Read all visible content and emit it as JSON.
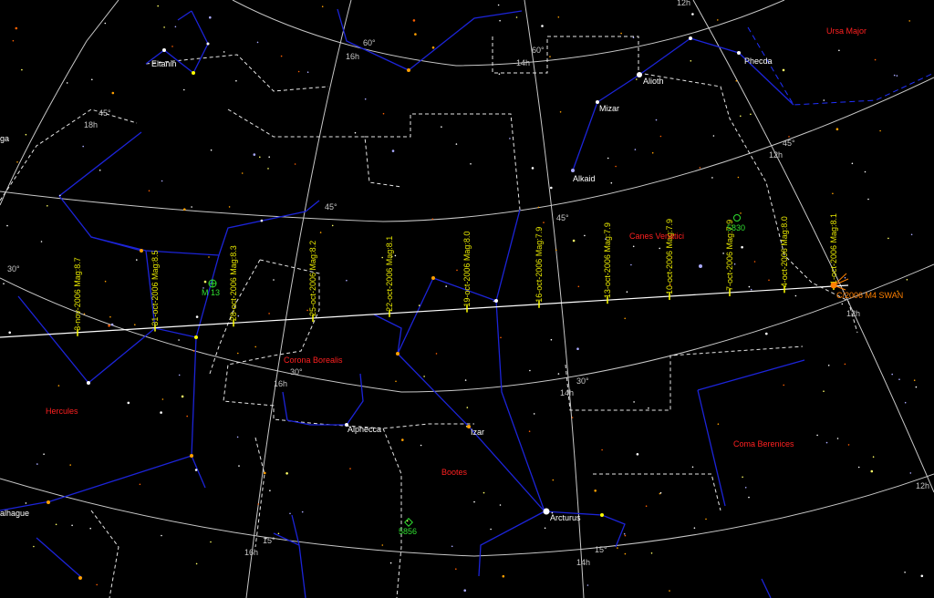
{
  "colors": {
    "background": "#000000",
    "grid": "#c8c8c8",
    "boundary": "#e6e6e6",
    "constellation_line": "#1c24d8",
    "ecliptic_dash": "#2030ff",
    "comet_path": "#ffffff",
    "comet_tick": "#ffff00",
    "date_label": "#e8e800",
    "const_name": "#ff2020",
    "star_label": "#ffffff",
    "dso": "#30e030",
    "comet_label": "#ff8000"
  },
  "constellation_names": [
    "Ursa Major",
    "Canes Venatici",
    "Corona Borealis",
    "Hercules",
    "Bootes",
    "Coma Berenices"
  ],
  "star_names": [
    "Eltanin",
    "Alioth",
    "Phecda",
    "Mizar",
    "Alkaid",
    "Alphecca",
    "Izar",
    "Arcturus",
    "alhague",
    "ga"
  ],
  "grid_labels": [
    "60°",
    "60°",
    "16h",
    "14h",
    "12h",
    "45°",
    "18h",
    "45°",
    "45°",
    "12h",
    "45°",
    "30°",
    "30°",
    "30°",
    "16h",
    "14h",
    "12h",
    "12h",
    "15°",
    "15°",
    "16h",
    "14h"
  ],
  "dso_labels": [
    "M 13",
    "5830",
    "5856"
  ],
  "comet": {
    "name": "C/2006 M4 SWAN",
    "marks": [
      "3-nov-2006  Mag:8.7",
      "31-oct-2006  Mag:8.5",
      "28-oct-2006  Mag:8.3",
      "25-oct-2006  Mag:8.2",
      "22-oct-2006  Mag:8.1",
      "19-oct-2006  Mag:8.0",
      "16-oct-2006  Mag:7.9",
      "13-oct-2006  Mag:7.9",
      "10-oct-2006  Mag:7.9",
      "7-oct-2006  Mag:7.9",
      "4-oct-2006  Mag:8.0",
      "1-oct-2006  Mag:8.1"
    ]
  }
}
